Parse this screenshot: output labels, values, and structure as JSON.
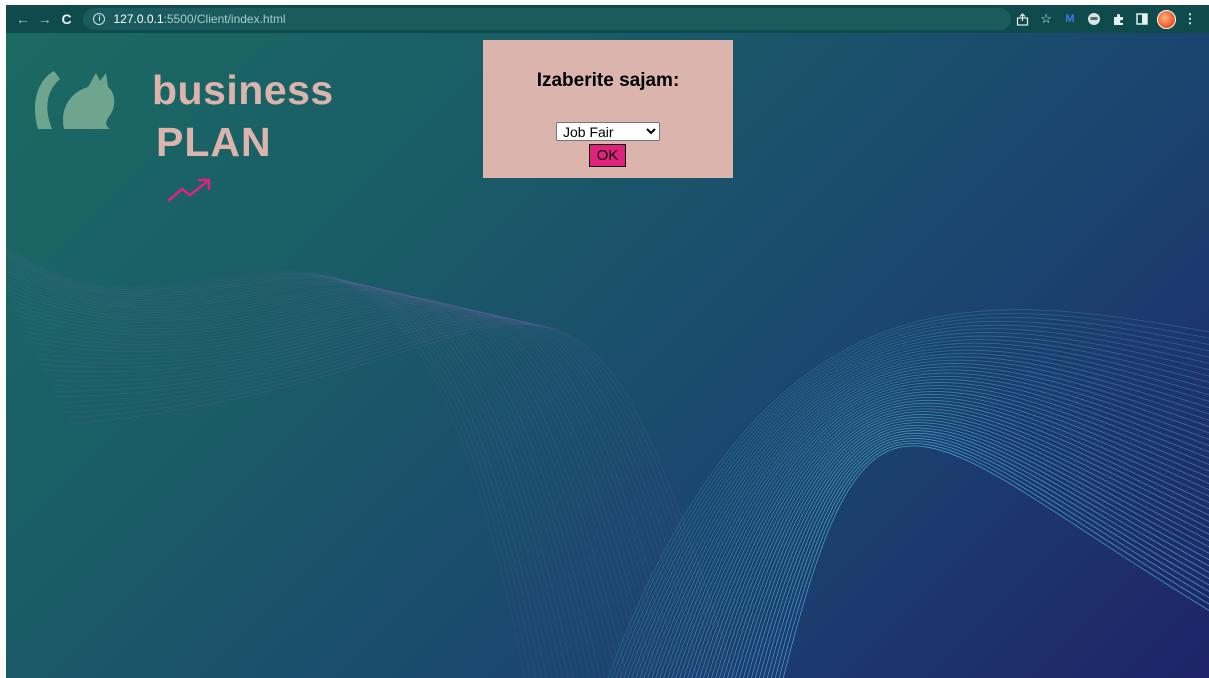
{
  "browser": {
    "url_host": "127.0.0.1",
    "url_path": ":5500/Client/index.html",
    "nav": {
      "back_icon": "←",
      "forward_icon": "→",
      "reload_icon": "C"
    },
    "toolbar_icons": [
      "share-icon",
      "star-icon",
      "extension-m-icon",
      "extension-robot-icon",
      "puzzle-icon",
      "sidepanel-icon",
      "profile-avatar",
      "kebab-menu-icon"
    ]
  },
  "logo": {
    "line1": "business",
    "line2": "PLAN",
    "cat_color": "#6fa58f",
    "text_color": "#dbb4ad",
    "arrow_color": "#e0227e"
  },
  "dialog": {
    "title": "Izaberite sajam:",
    "select": {
      "selected": "Job Fair"
    },
    "ok_label": "OK",
    "bg_color": "#dbb4ad",
    "button_color": "#e0227e"
  }
}
